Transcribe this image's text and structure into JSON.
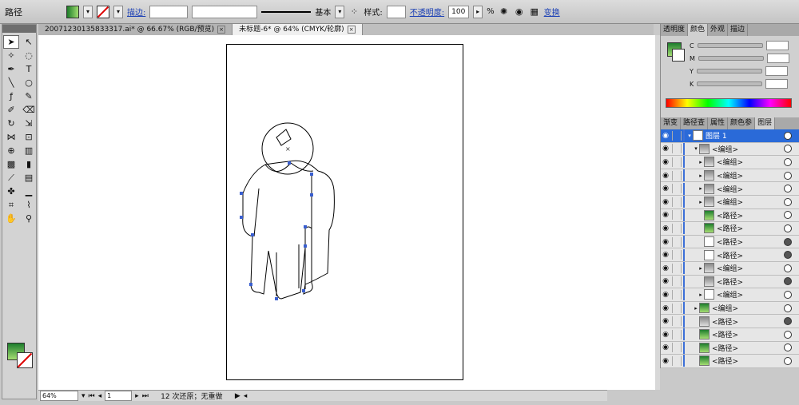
{
  "control_bar": {
    "object_type": "路径",
    "stroke_label": "描边:",
    "stroke_weight": "",
    "stroke_profile": "基本",
    "style_label": "样式:",
    "opacity_label": "不透明度:",
    "opacity_value": "100",
    "opacity_unit": "%",
    "transform_label": "变换"
  },
  "doc_tabs": [
    {
      "label": "20071230135833317.ai* @ 66.67% (RGB/预览)"
    },
    {
      "label": "未标题-6* @ 64% (CMYK/轮廓)"
    }
  ],
  "color_panel": {
    "tabs": [
      "透明度",
      "颜色",
      "外观",
      "描边"
    ],
    "channels": [
      "C",
      "M",
      "Y",
      "K"
    ]
  },
  "layers_panel": {
    "tabs": [
      "渐变",
      "路径查",
      "属性",
      "颜色参",
      "图层"
    ],
    "rows": [
      {
        "name": "图层 1",
        "depth": 0
      },
      {
        "name": "<编组>",
        "depth": 1
      },
      {
        "name": "<编组>",
        "depth": 2
      },
      {
        "name": "<编组>",
        "depth": 2
      },
      {
        "name": "<编组>",
        "depth": 2
      },
      {
        "name": "<编组>",
        "depth": 2
      },
      {
        "name": "<路径>",
        "depth": 2
      },
      {
        "name": "<路径>",
        "depth": 2
      },
      {
        "name": "<路径>",
        "depth": 2
      },
      {
        "name": "<路径>",
        "depth": 2
      },
      {
        "name": "<编组>",
        "depth": 2
      },
      {
        "name": "<路径>",
        "depth": 2
      },
      {
        "name": "<编组>",
        "depth": 2
      },
      {
        "name": "<编组>",
        "depth": 1
      },
      {
        "name": "<路径>",
        "depth": 1
      },
      {
        "name": "<路径>",
        "depth": 1
      },
      {
        "name": "<路径>",
        "depth": 1
      },
      {
        "name": "<路径>",
        "depth": 1
      }
    ]
  },
  "status_bar": {
    "zoom": "64%",
    "page": "1",
    "status_text": "12 次还原；无重做"
  }
}
